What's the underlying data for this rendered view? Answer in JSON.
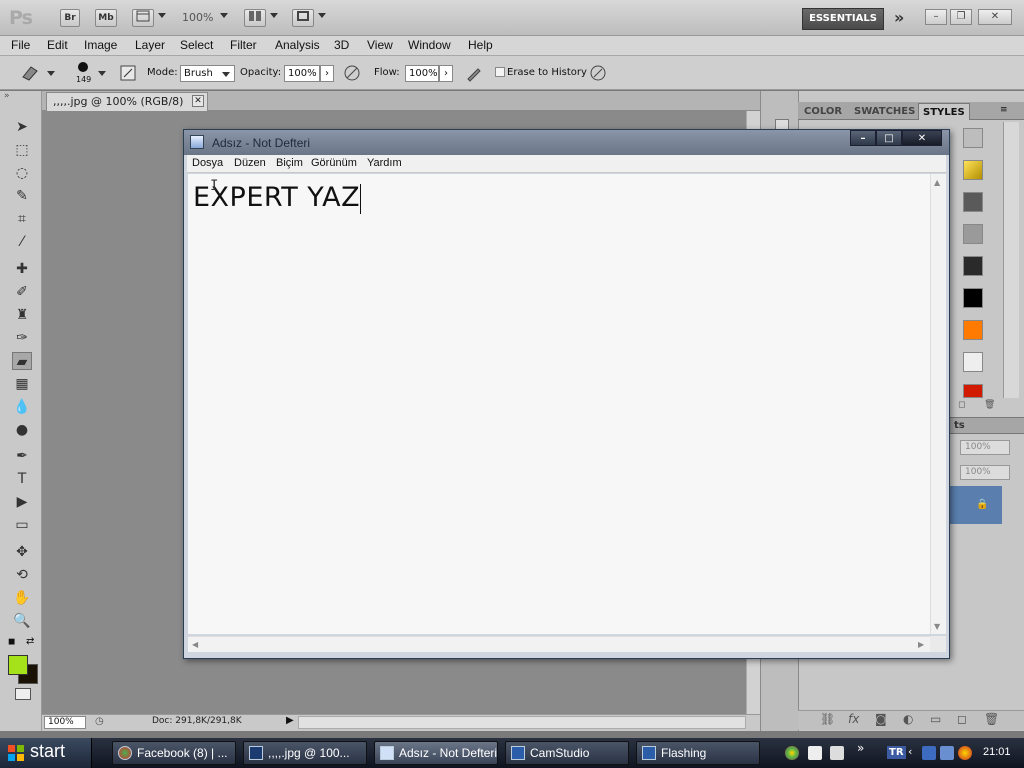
{
  "appbar": {
    "logo": "Ps",
    "br": "Br",
    "mb": "Mb",
    "zoom": "100%",
    "essentials": "ESSENTIALS",
    "more": "»"
  },
  "menubar": [
    "File",
    "Edit",
    "Image",
    "Layer",
    "Select",
    "Filter",
    "Analysis",
    "3D",
    "View",
    "Window",
    "Help"
  ],
  "options": {
    "brush_size": "149",
    "mode_label": "Mode:",
    "mode_value": "Brush",
    "opacity_label": "Opacity:",
    "opacity_value": "100%",
    "flow_label": "Flow:",
    "flow_value": "100%",
    "erase_history": "Erase to History"
  },
  "document": {
    "tab_title": ",,,,.jpg @ 100% (RGB/8)",
    "zoom": "100%",
    "info": "Doc: 291,8K/291,8K"
  },
  "right_panel": {
    "tabs": [
      "COLOR",
      "SWATCHES",
      "STYLES"
    ],
    "active_tab": "STYLES",
    "panel2_label": "ts",
    "fill_pct_1": "100%",
    "fill_pct_2": "100%"
  },
  "notepad": {
    "title": "Adsız - Not Defteri",
    "menu": [
      "Dosya",
      "Düzen",
      "Biçim",
      "Görünüm",
      "Yardım"
    ],
    "content": "EXPERT YAZ"
  },
  "taskbar": {
    "start": "start",
    "items": [
      "Facebook (8) | ...",
      ",,,,.jpg @ 100...",
      "Adsız - Not Defteri",
      "CamStudio",
      "Flashing"
    ],
    "active_index": 2,
    "lang": "TR",
    "clock": "21:01",
    "chevron": "»"
  },
  "colors": {
    "foreground": "#a6e21a",
    "background": "#1a1205",
    "layer_selection": "#5a7fae"
  }
}
